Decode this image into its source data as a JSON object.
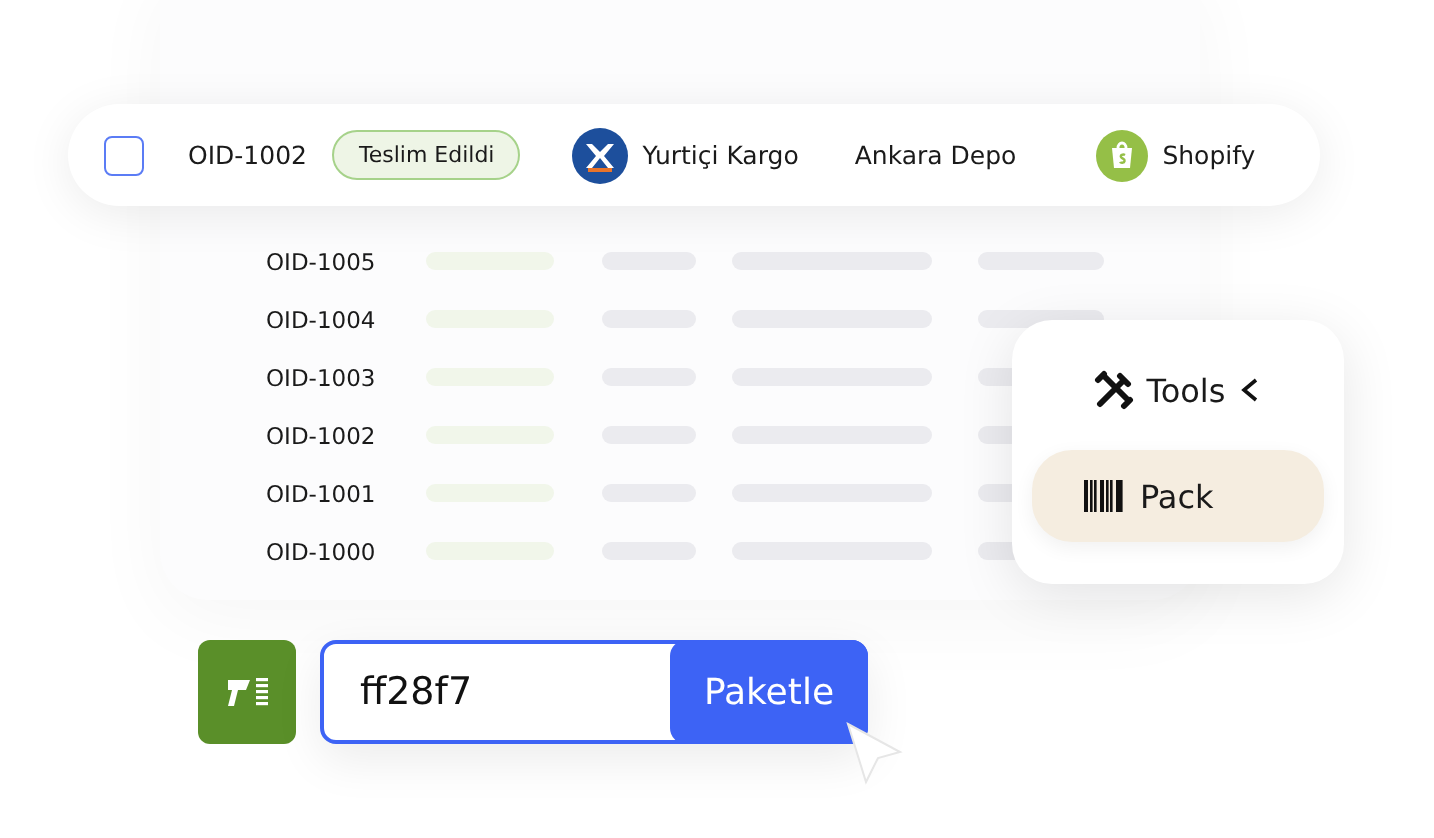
{
  "order_row": {
    "checked": false,
    "order_id": "OID-1002",
    "status": "Teslim Edildi",
    "carrier": "Yurtiçi Kargo",
    "warehouse": "Ankara Depo",
    "store": "Shopify"
  },
  "orders": [
    {
      "order_id": "OID-1005"
    },
    {
      "order_id": "OID-1004"
    },
    {
      "order_id": "OID-1003"
    },
    {
      "order_id": "OID-1002"
    },
    {
      "order_id": "OID-1001"
    },
    {
      "order_id": "OID-1000"
    }
  ],
  "tools_menu": {
    "title": "Tools",
    "expanded": true,
    "items": [
      {
        "label": "Pack",
        "selected": true
      }
    ]
  },
  "scan": {
    "value": "ff28f7",
    "button": "Paketle"
  }
}
